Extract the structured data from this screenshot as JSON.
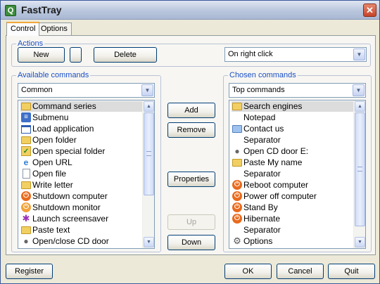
{
  "window": {
    "title": "FastTray",
    "app_icon": "app-icon",
    "close_icon": "close-icon"
  },
  "tabs": [
    {
      "label": "Control"
    },
    {
      "label": "Options"
    }
  ],
  "actions": {
    "legend": "Actions",
    "new_label": "New",
    "delete_label": "Delete",
    "trigger_value": "On right click"
  },
  "available": {
    "legend": "Available commands",
    "filter_value": "Common",
    "items": [
      {
        "label": "Command series",
        "icon": "command-series-icon"
      },
      {
        "label": "Submenu",
        "icon": "submenu-icon"
      },
      {
        "label": "Load application",
        "icon": "application-window-icon"
      },
      {
        "label": "Open folder",
        "icon": "folder-icon"
      },
      {
        "label": "Open special folder",
        "icon": "special-folder-icon"
      },
      {
        "label": "Open URL",
        "icon": "url-icon"
      },
      {
        "label": "Open file",
        "icon": "file-icon"
      },
      {
        "label": "Write letter",
        "icon": "letter-icon"
      },
      {
        "label": "Shutdown computer",
        "icon": "shutdown-icon"
      },
      {
        "label": "Shutdown monitor",
        "icon": "monitor-power-icon"
      },
      {
        "label": "Launch screensaver",
        "icon": "screensaver-icon"
      },
      {
        "label": "Paste text",
        "icon": "paste-icon"
      },
      {
        "label": "Open/close CD door",
        "icon": "cd-door-icon"
      }
    ]
  },
  "middle": {
    "add_label": "Add",
    "remove_label": "Remove",
    "properties_label": "Properties",
    "up_label": "Up",
    "down_label": "Down"
  },
  "chosen": {
    "legend": "Chosen commands",
    "filter_value": "Top commands",
    "items": [
      {
        "label": "Search engines",
        "icon": "search-engines-icon"
      },
      {
        "label": "Notepad",
        "icon": ""
      },
      {
        "label": "Contact us",
        "icon": "contact-icon"
      },
      {
        "label": "Separator",
        "icon": ""
      },
      {
        "label": "Open CD door E:",
        "icon": "cd-door-icon"
      },
      {
        "label": "Paste My name",
        "icon": "paste-icon"
      },
      {
        "label": "Separator",
        "icon": ""
      },
      {
        "label": "Reboot computer",
        "icon": "reboot-icon"
      },
      {
        "label": "Power off computer",
        "icon": "power-off-icon"
      },
      {
        "label": "Stand By",
        "icon": "standby-icon"
      },
      {
        "label": "Hibernate",
        "icon": "hibernate-icon"
      },
      {
        "label": "Separator",
        "icon": ""
      },
      {
        "label": "Options",
        "icon": "options-icon"
      }
    ]
  },
  "footer": {
    "register_label": "Register",
    "ok_label": "OK",
    "cancel_label": "Cancel",
    "quit_label": "Quit"
  }
}
